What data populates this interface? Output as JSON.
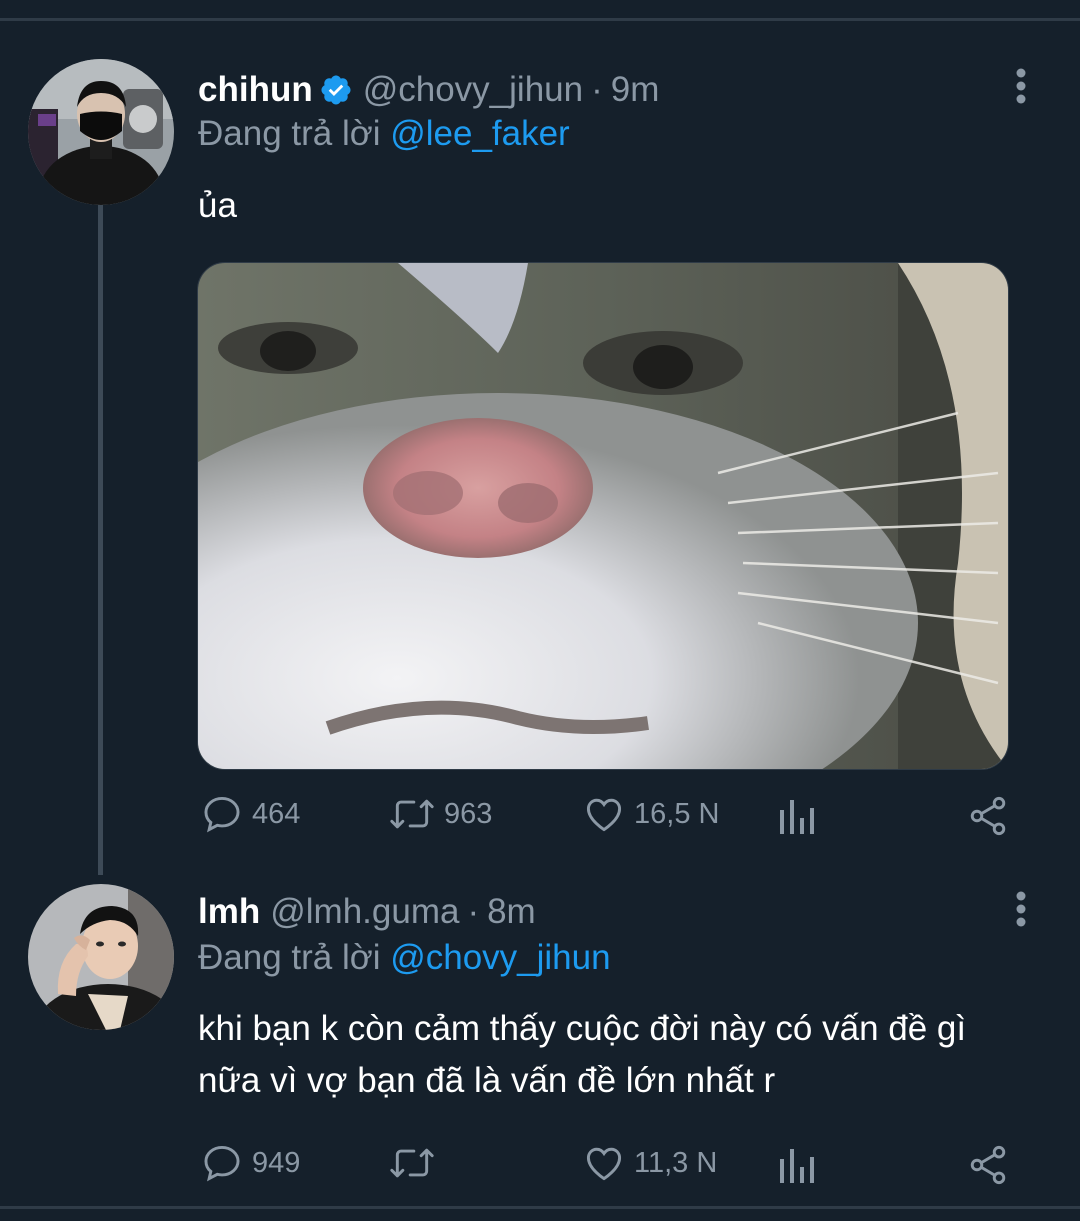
{
  "tweets": [
    {
      "display_name": "chihun",
      "handle": "@chovy_jihun",
      "separator": "·",
      "time": "9m",
      "reply_prefix": "Đang trả lời",
      "reply_to": "@lee_faker",
      "text": "ủa",
      "stats": {
        "replies": "464",
        "retweets": "963",
        "likes": "16,5 N"
      }
    },
    {
      "display_name": "lmh",
      "handle": "@lmh.guma",
      "separator": "·",
      "time": "8m",
      "reply_prefix": "Đang trả lời",
      "reply_to": "@chovy_jihun",
      "text_line1": "khi bạn k còn cảm thấy cuộc đời này có vấn đề gì",
      "text_line2": "nữa vì vợ bạn đã là vấn đề lớn nhất r",
      "stats": {
        "replies": "949",
        "retweets": "",
        "likes": "11,3 N"
      }
    }
  ],
  "colors": {
    "background": "#15202b",
    "secondary_text": "#8b98a5",
    "link": "#1d9bf0",
    "verified": "#1d9bf0"
  },
  "icons": [
    "verified-badge-icon",
    "more-vertical-icon",
    "reply-icon",
    "retweet-icon",
    "like-icon",
    "analytics-icon",
    "share-icon"
  ]
}
